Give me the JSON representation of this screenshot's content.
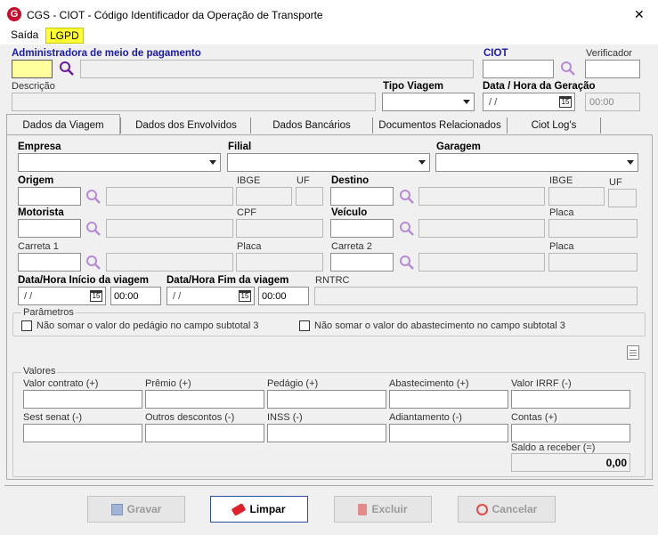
{
  "window": {
    "title": "CGS - CIOT - Código Identificador da Operação de Transporte",
    "close_glyph": "✕"
  },
  "menu": {
    "exit": "Saída",
    "lgpd": "LGPD"
  },
  "header": {
    "admin_label": "Administradora de meio de pagamento",
    "ciot_label": "CIOT",
    "verificador_label": "Verificador",
    "descricao_label": "Descrição",
    "tipo_viagem_label": "Tipo Viagem",
    "data_hora_label": "Data / Hora da Geração",
    "date_value": "/ /",
    "time_value": "00:00"
  },
  "tabs": [
    "Dados da Viagem",
    "Dados dos Envolvidos",
    "Dados Bancários",
    "Documentos Relacionados",
    "Ciot Log's"
  ],
  "form": {
    "empresa": "Empresa",
    "filial": "Filial",
    "garagem": "Garagem",
    "origem": "Origem",
    "ibge": "IBGE",
    "uf": "UF",
    "destino": "Destino",
    "motorista": "Motorista",
    "cpf": "CPF",
    "veiculo": "Veículo",
    "placa": "Placa",
    "carreta1": "Carreta 1",
    "carreta2": "Carreta 2",
    "inicio_viagem": "Data/Hora Início da viagem",
    "fim_viagem": "Data/Hora Fim da viagem",
    "rntrc": "RNTRC",
    "date_value": "/ /",
    "time_value": "00:00",
    "cal_day": "15"
  },
  "parametros": {
    "title": "Parâmetros",
    "chk1": "Não somar o valor do pedágio no campo subtotal 3",
    "chk2": "Não somar o valor do abastecimento no campo subtotal 3"
  },
  "valores": {
    "title": "Valores",
    "valor_contrato": "Valor contrato (+)",
    "premio": "Prêmio (+)",
    "pedagio": "Pedágio (+)",
    "abastecimento": "Abastecimento (+)",
    "irrf": "Valor IRRF (-)",
    "sest_senat": "Sest senat (-)",
    "outros_descontos": "Outros descontos (-)",
    "inss": "INSS (-)",
    "adiantamento": "Adiantamento (-)",
    "contas": "Contas (+)",
    "saldo_label": "Saldo a receber (=)",
    "saldo_value": "0,00"
  },
  "buttons": {
    "gravar": "Gravar",
    "limpar": "Limpar",
    "excluir": "Excluir",
    "cancelar": "Cancelar"
  },
  "colors": {
    "accent_blue": "#1a1aa6",
    "lgpd_bg": "#ffff33",
    "logo_red": "#c8102e"
  }
}
